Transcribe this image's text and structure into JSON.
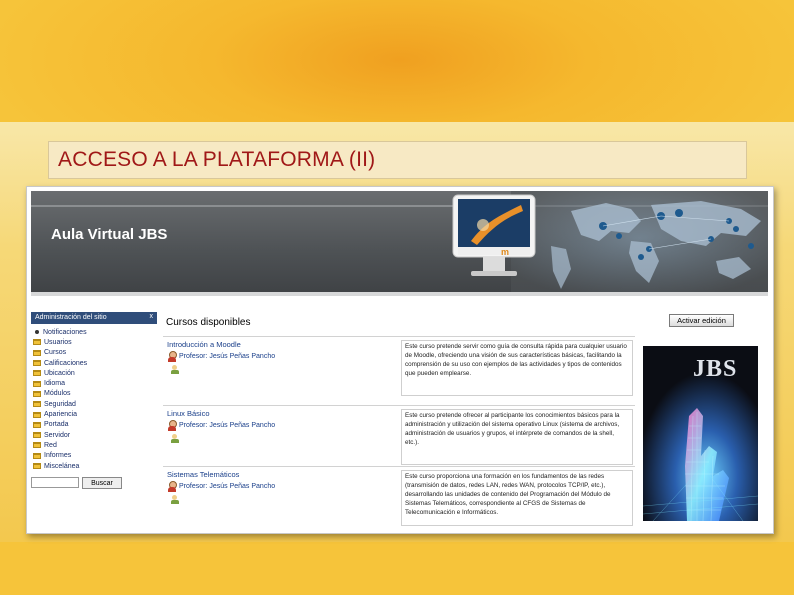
{
  "slide": {
    "title": "ACCESO A LA PLATAFORMA (II)"
  },
  "site": {
    "name": "Aula Virtual JBS",
    "logo_letter": "m"
  },
  "sidebar": {
    "title": "Administración del sitio",
    "close_label": "x",
    "items": [
      {
        "label": "Notificaciones",
        "icon": "bullet-icon"
      },
      {
        "label": "Usuarios",
        "icon": "folder-icon"
      },
      {
        "label": "Cursos",
        "icon": "folder-icon"
      },
      {
        "label": "Calificaciones",
        "icon": "folder-icon"
      },
      {
        "label": "Ubicación",
        "icon": "folder-icon"
      },
      {
        "label": "Idioma",
        "icon": "folder-icon"
      },
      {
        "label": "Módulos",
        "icon": "folder-icon"
      },
      {
        "label": "Seguridad",
        "icon": "folder-icon"
      },
      {
        "label": "Apariencia",
        "icon": "folder-icon"
      },
      {
        "label": "Portada",
        "icon": "folder-icon"
      },
      {
        "label": "Servidor",
        "icon": "folder-icon"
      },
      {
        "label": "Red",
        "icon": "folder-icon"
      },
      {
        "label": "Informes",
        "icon": "folder-icon"
      },
      {
        "label": "Miscelánea",
        "icon": "folder-icon"
      }
    ],
    "search_value": "",
    "search_button": "Buscar"
  },
  "main": {
    "title": "Cursos disponibles",
    "edit_button": "Activar edición",
    "courses": [
      {
        "name": "Introducción a Moodle",
        "teacher": "Profesor: Jesús Peñas Pancho",
        "summary": "Este curso pretende servir como guía de consulta rápida para cualquier usuario de Moodle, ofreciendo una visión de sus características básicas, facilitando la comprensión de su uso con ejemplos de las actividades y tipos de contenidos que pueden emplearse."
      },
      {
        "name": "Linux Básico",
        "teacher": "Profesor: Jesús Peñas Pancho",
        "summary": "Este curso pretende ofrecer al participante los conocimientos básicos para la administración y utilización del sistema operativo Linux (sistema de archivos, administración de usuarios y grupos, el intérprete de comandos de la shell, etc.)."
      },
      {
        "name": "Sistemas Telemáticos",
        "teacher": "Profesor: Jesús Peñas Pancho",
        "summary": "Este curso proporciona una formación en los fundamentos de las redes (transmisión de datos, redes LAN, redes WAN, protocolos TCP/IP, etc.), desarrollando las unidades de contenido del Programación del Módulo de Sistemas Telemáticos, correspondiente al CFGS de Sistemas de Telecomunicación e Informáticos."
      }
    ]
  },
  "promo": {
    "logo_text": "JBS"
  },
  "colors": {
    "slide_background": "#f5b82e",
    "title_text": "#a01818",
    "header": "#4f5356",
    "sidebar_header": "#2f4d7a",
    "link": "#1a3f8a"
  }
}
